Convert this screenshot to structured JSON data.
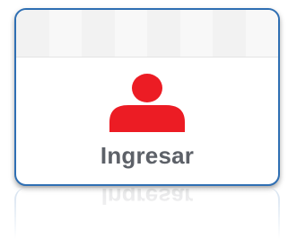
{
  "login_tile": {
    "label": "Ingresar",
    "icon": "user-icon",
    "icon_color": "#ec1c24",
    "border_color": "#2f6fb3",
    "label_color": "#5d6168"
  }
}
